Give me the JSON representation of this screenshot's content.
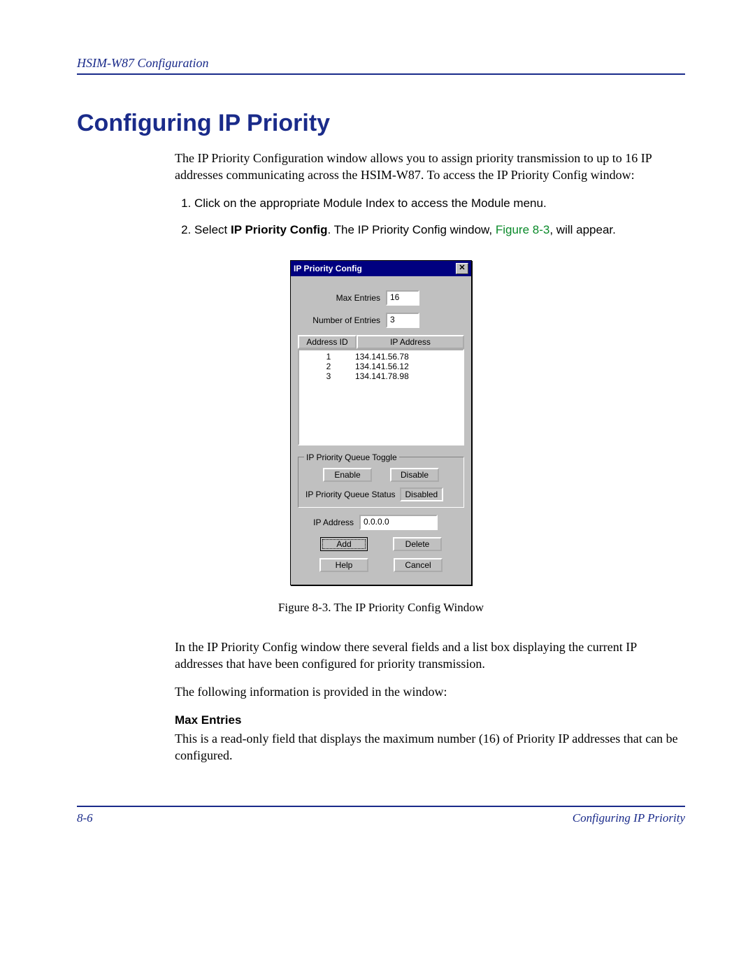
{
  "header": {
    "text": "HSIM-W87 Configuration"
  },
  "title": "Configuring IP Priority",
  "intro": "The IP Priority Configuration window allows you to assign priority transmission to up to 16 IP addresses communicating across the HSIM-W87. To access the IP Priority Config window:",
  "steps": [
    {
      "text": "Click on the appropriate Module Index to access the Module menu."
    },
    {
      "pre": "Select ",
      "bold": "IP Priority Config",
      "mid": ". The IP Priority Config window, ",
      "figref": "Figure 8-3",
      "post": ", will appear."
    }
  ],
  "dialog": {
    "title": "IP Priority Config",
    "close_glyph": "✕",
    "max_entries_label": "Max Entries",
    "max_entries_value": "16",
    "num_entries_label": "Number of Entries",
    "num_entries_value": "3",
    "col_address_id": "Address ID",
    "col_ip_address": "IP Address",
    "rows": [
      {
        "id": "1",
        "ip": "134.141.56.78"
      },
      {
        "id": "2",
        "ip": "134.141.56.12"
      },
      {
        "id": "3",
        "ip": "134.141.78.98"
      }
    ],
    "toggle_legend": "IP Priority Queue Toggle",
    "enable_label": "Enable",
    "disable_label": "Disable",
    "status_label": "IP Priority Queue Status",
    "status_value": "Disabled",
    "ip_address_label": "IP Address",
    "ip_address_value": "0.0.0.0",
    "add_label": "Add",
    "delete_label": "Delete",
    "help_label": "Help",
    "cancel_label": "Cancel"
  },
  "caption": "Figure 8-3. The IP Priority Config Window",
  "after1": "In the IP Priority Config window there several fields and a list box displaying the current IP addresses that have been configured for priority transmission.",
  "after2": "The following information is provided in the window:",
  "maxentries_head": "Max Entries",
  "maxentries_body": "This is a read-only field that displays the maximum number (16) of Priority IP addresses that can be configured.",
  "footer": {
    "left": "8-6",
    "right": "Configuring IP Priority"
  }
}
